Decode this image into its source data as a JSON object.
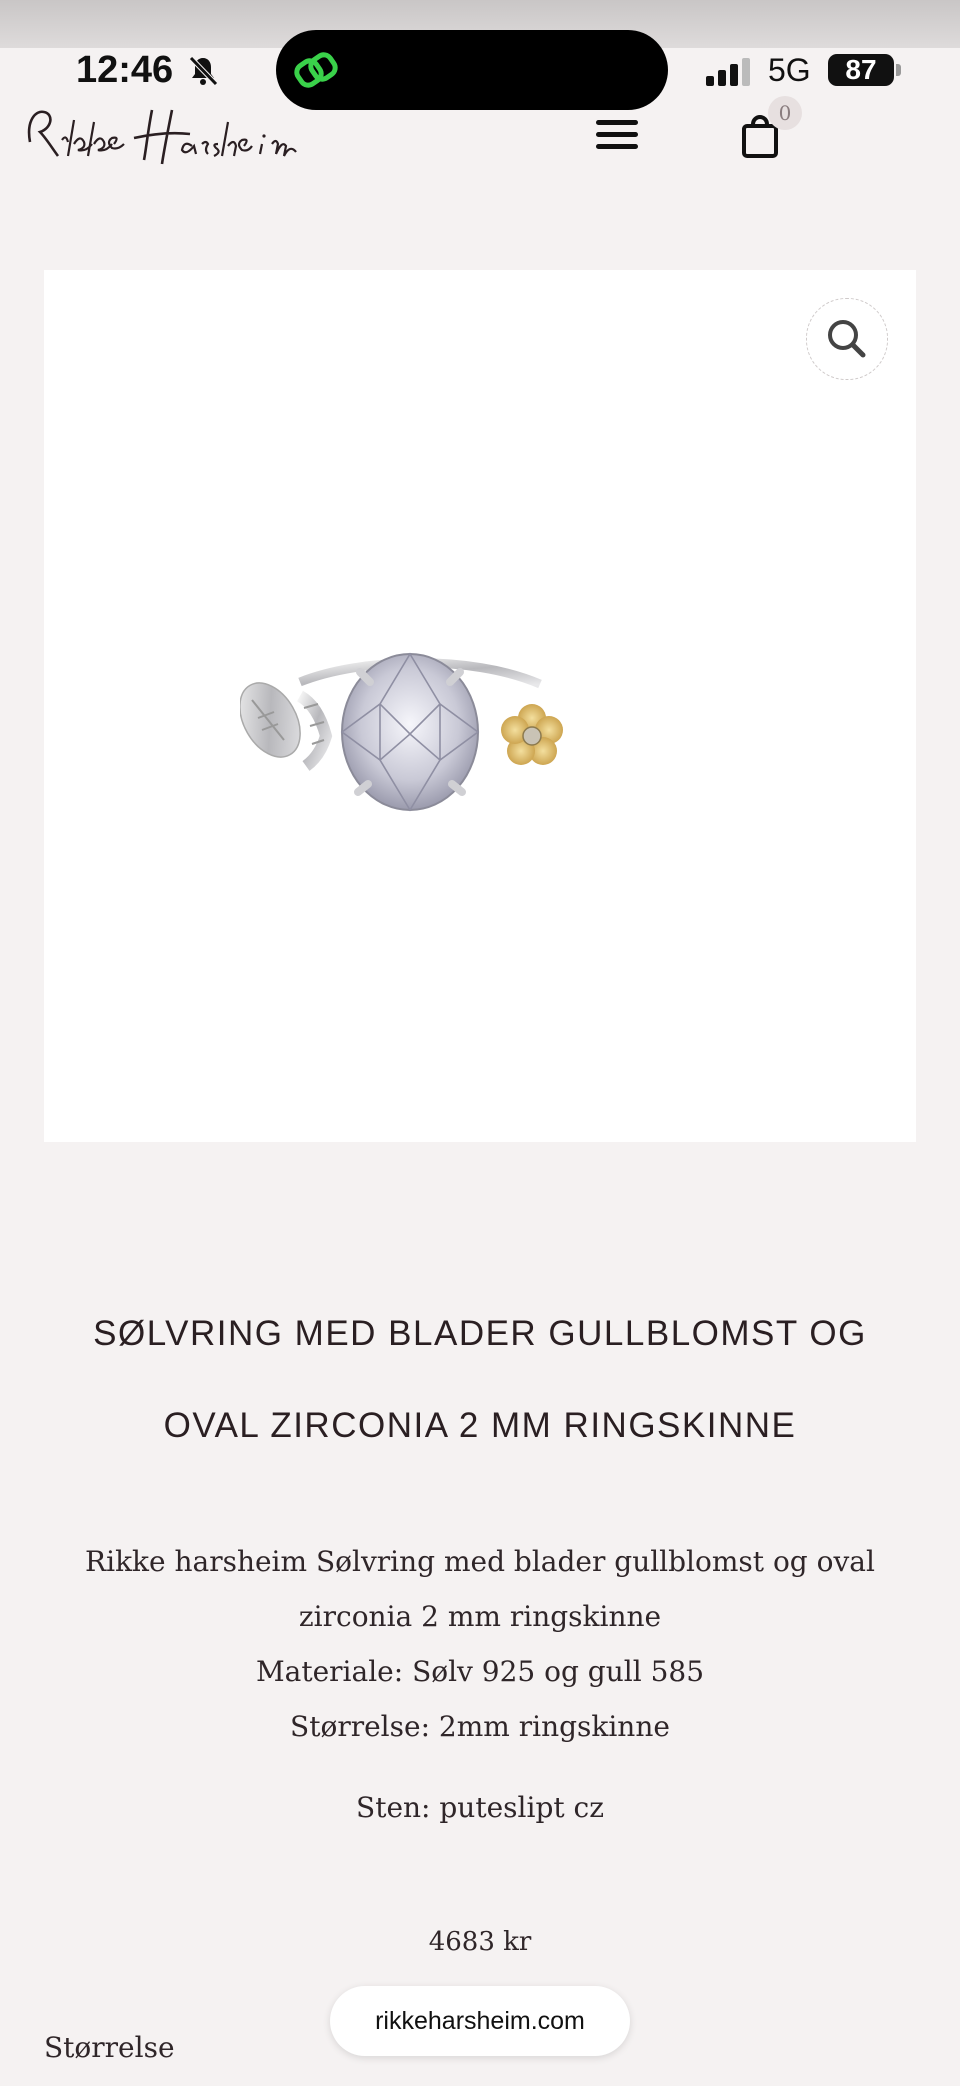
{
  "status_bar": {
    "time": "12:46",
    "network": "5G",
    "battery": "87",
    "icons": [
      "bell-muted-icon",
      "link-icon",
      "signal-icon"
    ]
  },
  "header": {
    "logo_text": "Rikke Harsheim",
    "cart_count": "0",
    "icons": [
      "menu-icon",
      "shopping-bag-icon"
    ]
  },
  "product": {
    "image_icon": "search-icon",
    "title_line1": "SØLVRING MED BLADER GULLBLOMST OG",
    "title_line2": "OVAL ZIRCONIA 2 MM RINGSKINNE",
    "description": {
      "line1": "Rikke harsheim Sølvring med blader gullblomst og oval",
      "line2": "zirconia 2 mm ringskinne",
      "line3": "Materiale: Sølv 925 og gull 585",
      "line4": "Størrelse: 2mm ringskinne"
    },
    "stone": "Sten: puteslipt cz",
    "price": "4683 kr",
    "size_label": "Størrelse"
  },
  "browser": {
    "url": "rikkeharsheim.com"
  },
  "colors": {
    "background": "#f5f2f2",
    "text": "#2a1f22",
    "accent_green": "#3ad14a"
  }
}
